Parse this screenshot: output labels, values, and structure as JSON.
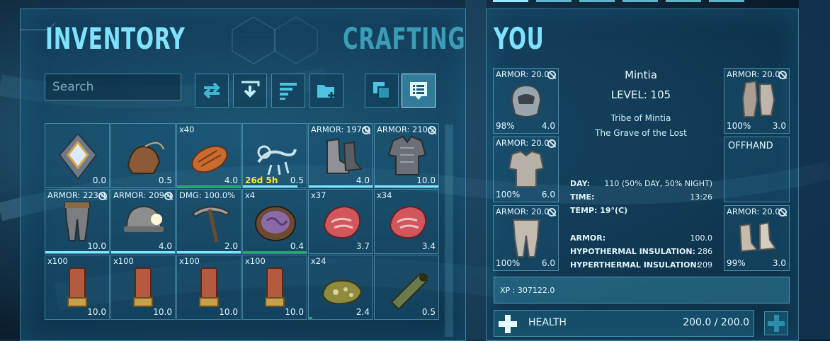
{
  "inventory": {
    "title": "INVENTORY",
    "crafting_tab": "CRAFTING",
    "search_placeholder": "Search",
    "toolbar": [
      "transfer-icon",
      "drop-icon",
      "sort-icon",
      "folder-icon",
      "stack-icon",
      "details-icon"
    ],
    "items": [
      {
        "name": "element",
        "top": "",
        "value": "0.0",
        "art": "crystal"
      },
      {
        "name": "saddle",
        "top": "",
        "value": "0.5",
        "art": "saddle"
      },
      {
        "name": "cooked-meat",
        "top": "x40",
        "value": "4.0",
        "art": "steak"
      },
      {
        "name": "skeleton",
        "top": "",
        "value": "0.5",
        "timer": "26d 5h",
        "art": "skeleton"
      },
      {
        "name": "armor-boots",
        "top": "ARMOR: 197.0",
        "value": "4.0",
        "art": "boots",
        "lock": true
      },
      {
        "name": "armor-chest",
        "top": "ARMOR: 210.2",
        "value": "10.0",
        "art": "chest",
        "lock": true
      },
      {
        "name": "armor-pants",
        "top": "ARMOR: 223.4",
        "value": "10.0",
        "art": "pants",
        "lock": true
      },
      {
        "name": "armor-helmet",
        "top": "ARMOR: 209.4",
        "value": "4.0",
        "art": "helmet",
        "lock": true
      },
      {
        "name": "pickaxe",
        "top": "DMG: 100.0%",
        "value": "2.0",
        "art": "pick"
      },
      {
        "name": "kibble-bowl",
        "top": "x4",
        "value": "0.4",
        "art": "bowl"
      },
      {
        "name": "raw-meat",
        "top": "x37",
        "value": "3.7",
        "art": "meat"
      },
      {
        "name": "raw-meat",
        "top": "x34",
        "value": "3.4",
        "art": "meat"
      },
      {
        "name": "shotgun-shell",
        "top": "x100",
        "value": "10.0",
        "art": "shell"
      },
      {
        "name": "shotgun-shell",
        "top": "x100",
        "value": "10.0",
        "art": "shell"
      },
      {
        "name": "shotgun-shell",
        "top": "x100",
        "value": "10.0",
        "art": "shell"
      },
      {
        "name": "shotgun-shell",
        "top": "x100",
        "value": "10.0",
        "art": "shell"
      },
      {
        "name": "spoiled-item",
        "top": "x24",
        "value": "2.4",
        "art": "spoil"
      },
      {
        "name": "scope",
        "top": "",
        "value": "0.5",
        "art": "scope"
      }
    ]
  },
  "you": {
    "title": "YOU",
    "name": "Mintia",
    "level": "LEVEL: 105",
    "tribe": "Tribe of Mintia",
    "map": "The Grave of the Lost",
    "offhand": "OFFHAND",
    "day_label": "DAY:",
    "day_value": "110 (50% DAY, 50% NIGHT)",
    "time_label": "TIME:",
    "time_value": "13:26",
    "temp_label": "TEMP: 19°(C)",
    "armor_label": "ARMOR:",
    "armor_value": "100.0",
    "hypo_label": "HYPOTHERMAL INSULATION:",
    "hypo_value": "286",
    "hyper_label": "HYPERTHERMAL INSULATION:",
    "hyper_value": "209",
    "xp": "XP : 307122.0",
    "health_label": "HEALTH",
    "health_value": "200.0 / 200.0",
    "equipment": [
      {
        "slot": "head",
        "armor": "ARMOR: 20.0",
        "pct": "98%",
        "weight": "4.0"
      },
      {
        "slot": "chest",
        "armor": "ARMOR: 20.0",
        "pct": "100%",
        "weight": "6.0"
      },
      {
        "slot": "legs",
        "armor": "ARMOR: 20.0",
        "pct": "100%",
        "weight": "6.0"
      },
      {
        "slot": "hands",
        "armor": "ARMOR: 20.0",
        "pct": "100%",
        "weight": "3.0"
      },
      {
        "slot": "feet",
        "armor": "ARMOR: 20.0",
        "pct": "99%",
        "weight": "3.0"
      }
    ]
  },
  "colors": {
    "accent": "#7ee4ff",
    "title": "#7fe3ff",
    "crafting": "#3b9cb6",
    "timer": "#ffe633",
    "durability": "#24a86c"
  }
}
